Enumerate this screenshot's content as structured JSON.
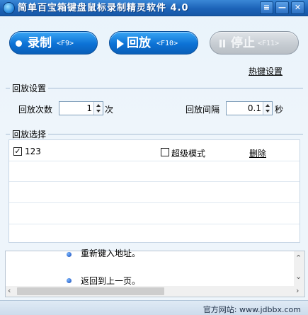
{
  "window": {
    "title": "简单百宝箱键盘鼠标录制精灵软件 4.0",
    "controls": [
      "≡",
      "—",
      "✕"
    ]
  },
  "toolbar": {
    "record_label": "录制",
    "record_key": "<F9>",
    "play_label": "回放",
    "play_key": "<F10>",
    "stop_label": "停止",
    "stop_key": "<F11>"
  },
  "hotkey_link": "热键设置",
  "playback_settings": {
    "title": "回放设置",
    "count_label": "回放次数",
    "count_value": "1",
    "count_unit": "次",
    "interval_label": "回放间隔",
    "interval_value": "0.1",
    "interval_unit": "秒"
  },
  "playback_selection": {
    "title": "回放选择",
    "items": [
      {
        "name": "123",
        "checked": true,
        "super_mode_label": "超级模式",
        "super_mode_checked": false,
        "delete_label": "删除"
      }
    ]
  },
  "web_content": {
    "lines": [
      "重新键入地址。",
      "返回到上一页。"
    ]
  },
  "footer": {
    "text": "官方网站: www.jdbbx.com"
  }
}
